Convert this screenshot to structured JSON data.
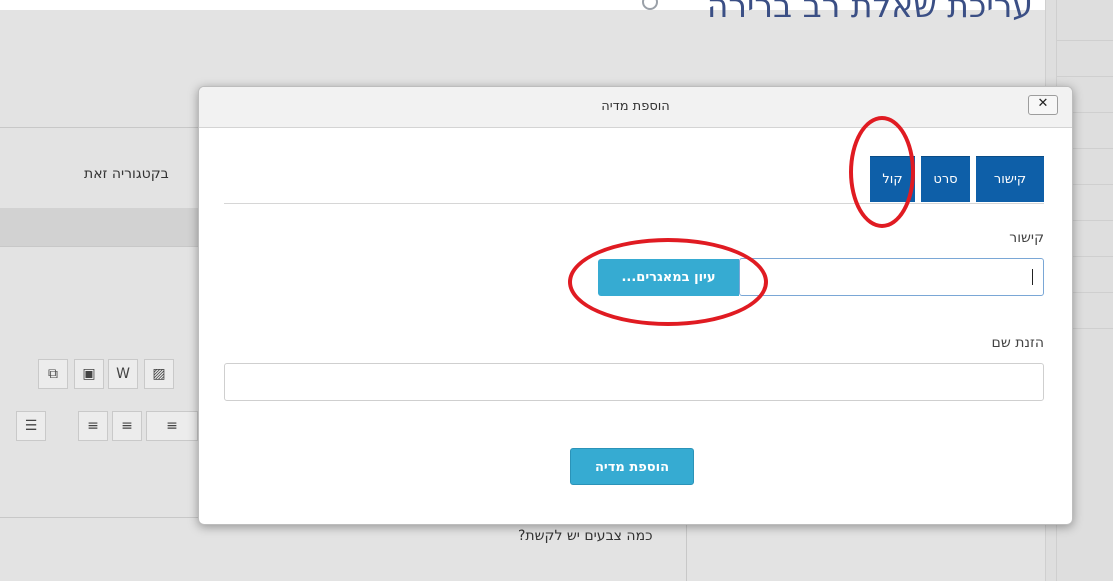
{
  "background_page": {
    "title": "עריכת שאלת רב ברירה",
    "category_text": "בקטגוריה זאת",
    "question_text": "כמה צבעים יש לקשת?"
  },
  "modal": {
    "title": "הוספת מדיה",
    "close_label": "✕",
    "tabs": [
      {
        "label": "קישור"
      },
      {
        "label": "סרט"
      },
      {
        "label": "קול"
      }
    ],
    "link_label": "קישור",
    "link_value": "",
    "browse_button": "עיון במאגרים...",
    "name_label": "הזנת שם",
    "name_value": "",
    "submit_button": "הוספת מדיה"
  },
  "colors": {
    "tab_bg": "#0e5fa8",
    "button_bg": "#36abd2",
    "annotation": "#e01b22",
    "title_color": "#3b4f85"
  }
}
